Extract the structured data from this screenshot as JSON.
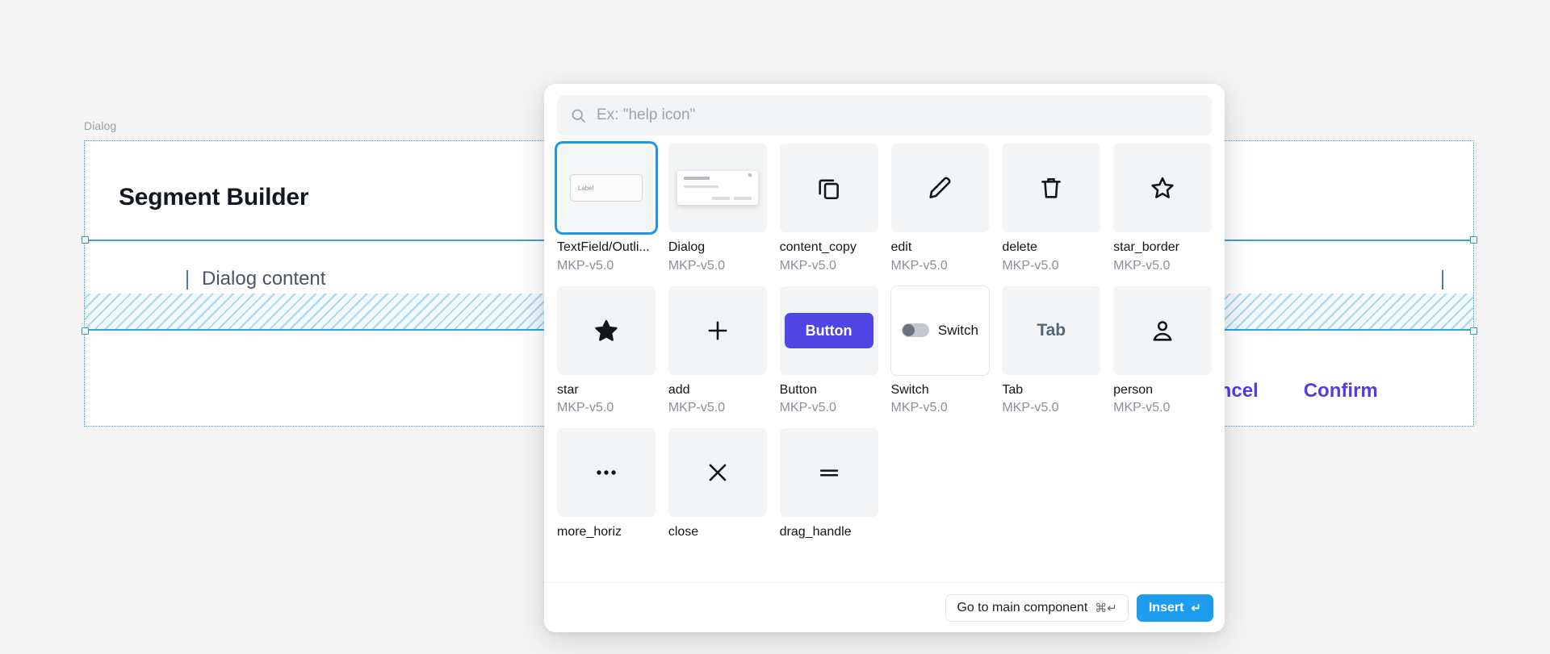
{
  "canvas": {
    "frame_label": "Dialog",
    "dialog_title": "Segment Builder",
    "content_placeholder": "Dialog content",
    "actions": [
      {
        "label": "Cancel",
        "name": "cancel-button"
      },
      {
        "label": "Confirm",
        "name": "confirm-button"
      }
    ],
    "accent_color": "#4f3fe0",
    "selection_color": "#2f9ad6"
  },
  "picker": {
    "search": {
      "placeholder": "Ex: \"help icon\"",
      "value": "",
      "icon": "search-icon"
    },
    "items": [
      {
        "name": "TextField/Outli...",
        "library": "MKP-v5.0",
        "thumb": "textfield",
        "thumb_label": "Label",
        "selected": true
      },
      {
        "name": "Dialog",
        "library": "MKP-v5.0",
        "thumb": "dialog",
        "selected": false
      },
      {
        "name": "content_copy",
        "library": "MKP-v5.0",
        "thumb": "content_copy-icon",
        "selected": false
      },
      {
        "name": "edit",
        "library": "MKP-v5.0",
        "thumb": "edit-icon",
        "selected": false
      },
      {
        "name": "delete",
        "library": "MKP-v5.0",
        "thumb": "delete-icon",
        "selected": false
      },
      {
        "name": "star_border",
        "library": "MKP-v5.0",
        "thumb": "star-border-icon",
        "selected": false
      },
      {
        "name": "star",
        "library": "MKP-v5.0",
        "thumb": "star-icon",
        "selected": false
      },
      {
        "name": "add",
        "library": "MKP-v5.0",
        "thumb": "add-icon",
        "selected": false
      },
      {
        "name": "Button",
        "library": "MKP-v5.0",
        "thumb": "button",
        "thumb_label": "Button",
        "selected": false
      },
      {
        "name": "Switch",
        "library": "MKP-v5.0",
        "thumb": "switch",
        "thumb_label": "Switch",
        "selected": false,
        "bordered": true
      },
      {
        "name": "Tab",
        "library": "MKP-v5.0",
        "thumb": "tab",
        "thumb_label": "Tab",
        "selected": false
      },
      {
        "name": "person",
        "library": "MKP-v5.0",
        "thumb": "person-icon",
        "selected": false
      },
      {
        "name": "more_horiz",
        "library": "",
        "thumb": "more-horiz-icon",
        "selected": false
      },
      {
        "name": "close",
        "library": "",
        "thumb": "close-icon",
        "selected": false
      },
      {
        "name": "drag_handle",
        "library": "",
        "thumb": "drag-handle-icon",
        "selected": false
      }
    ],
    "footer": {
      "secondary_label": "Go to main component",
      "secondary_shortcut": "⌘↵",
      "primary_label": "Insert",
      "primary_shortcut": "↵",
      "primary_color": "#1e9cf0"
    }
  }
}
